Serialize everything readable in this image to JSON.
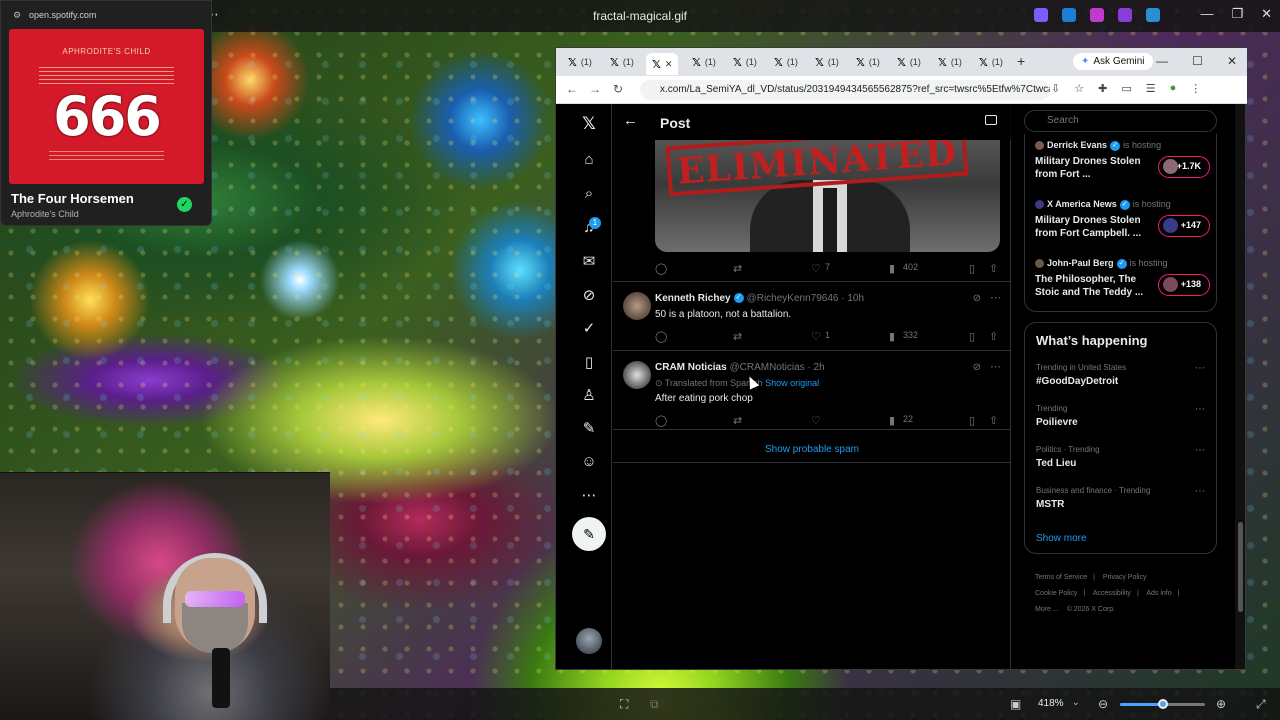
{
  "viewer": {
    "title": "fractal-magical.gif",
    "zoom": "418%",
    "zoom_fraction": 0.5
  },
  "spotify": {
    "url": "open.spotify.com",
    "album_artist": "APHRODITE'S CHILD",
    "album_number": "666",
    "track": "The Four Horsemen",
    "artist": "Aphrodite's Child"
  },
  "browser": {
    "tab_badge": "(1)",
    "ask_gemini": "Ask Gemini",
    "url": "x.com/La_SemiYA_dl_VD/status/2031949434565562875?ref_src=twsrc%5Etfw%7Ctwcamp%..."
  },
  "x": {
    "header_title": "Post",
    "notif_badge": "1",
    "media_stamp": "ELIMINATED",
    "top_post_actions": {
      "likes": "7",
      "views": "402"
    },
    "replies": [
      {
        "name": "Kenneth Richey",
        "handle": "@RicheyKenn79646 · 10h",
        "text": "50 is a platoon, not a battalion.",
        "likes": "1",
        "views": "332"
      },
      {
        "name": "CRAM Noticias",
        "handle": "@CRAMNoticias · 2h",
        "translated": "Translated from Spanish",
        "show_original": "Show original",
        "text": "After eating pork chop",
        "likes": "",
        "views": "22"
      }
    ],
    "show_spam": "Show probable spam",
    "search_placeholder": "Search",
    "spaces": [
      {
        "host": "Derrick Evans",
        "status": "is hosting",
        "title": "Military Drones Stolen from Fort ...",
        "count": "+1.7K"
      },
      {
        "host": "X America News",
        "status": "is hosting",
        "title": "Military Drones Stolen from Fort Campbell. ...",
        "count": "+147"
      },
      {
        "host": "John-Paul Berg",
        "status": "is hosting",
        "title": "The Philosopher, The Stoic and The Teddy ...",
        "count": "+138"
      }
    ],
    "whats_happening": "What’s happening",
    "trends": [
      {
        "context": "Trending in United States",
        "name": "#GoodDayDetroit"
      },
      {
        "context": "Trending",
        "name": "Poilievre"
      },
      {
        "context": "Politics · Trending",
        "name": "Ted Lieu"
      },
      {
        "context": "Business and finance · Trending",
        "name": "MSTR"
      }
    ],
    "show_more": "Show more",
    "footer": [
      "Terms of Service",
      "|",
      "Privacy Policy",
      "|",
      "Cookie Policy",
      "|",
      "Accessibility",
      "|",
      "Ads info",
      "|",
      "More ...",
      "© 2026 X Corp."
    ]
  }
}
